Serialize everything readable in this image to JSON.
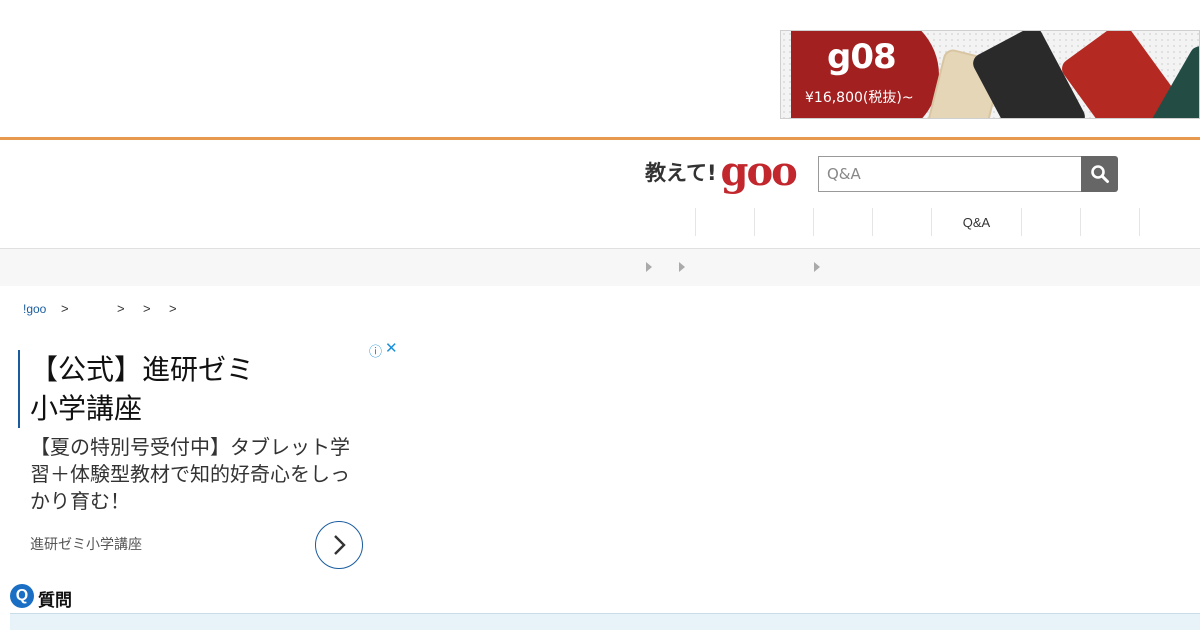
{
  "banner_ad": {
    "brand": "g08",
    "price": "¥16,800(税抜)~"
  },
  "header": {
    "logo_text": "教えて!",
    "logo_brand": "goo",
    "search": {
      "placeholder": "Q&A",
      "value": ""
    }
  },
  "nav": {
    "items": [
      "",
      "",
      "",
      "",
      "Q&A",
      "",
      "",
      ""
    ]
  },
  "breadcrumb": {
    "home": "!goo",
    "separator": ">"
  },
  "text_ad": {
    "title": "【公式】進研ゼミ小学講座",
    "body": "【夏の特別号受付中】タブレット学習＋体験型教材で知的好奇心をしっかり育む！",
    "source": "進研ゼミ小学講座",
    "info_icon": "ⓘ",
    "close_icon": "✕"
  },
  "question": {
    "badge": "Q",
    "label": "質問"
  },
  "colors": {
    "accent_orange": "#e79a4e",
    "brand_red": "#c1272d",
    "link_blue": "#1a5c9e"
  }
}
